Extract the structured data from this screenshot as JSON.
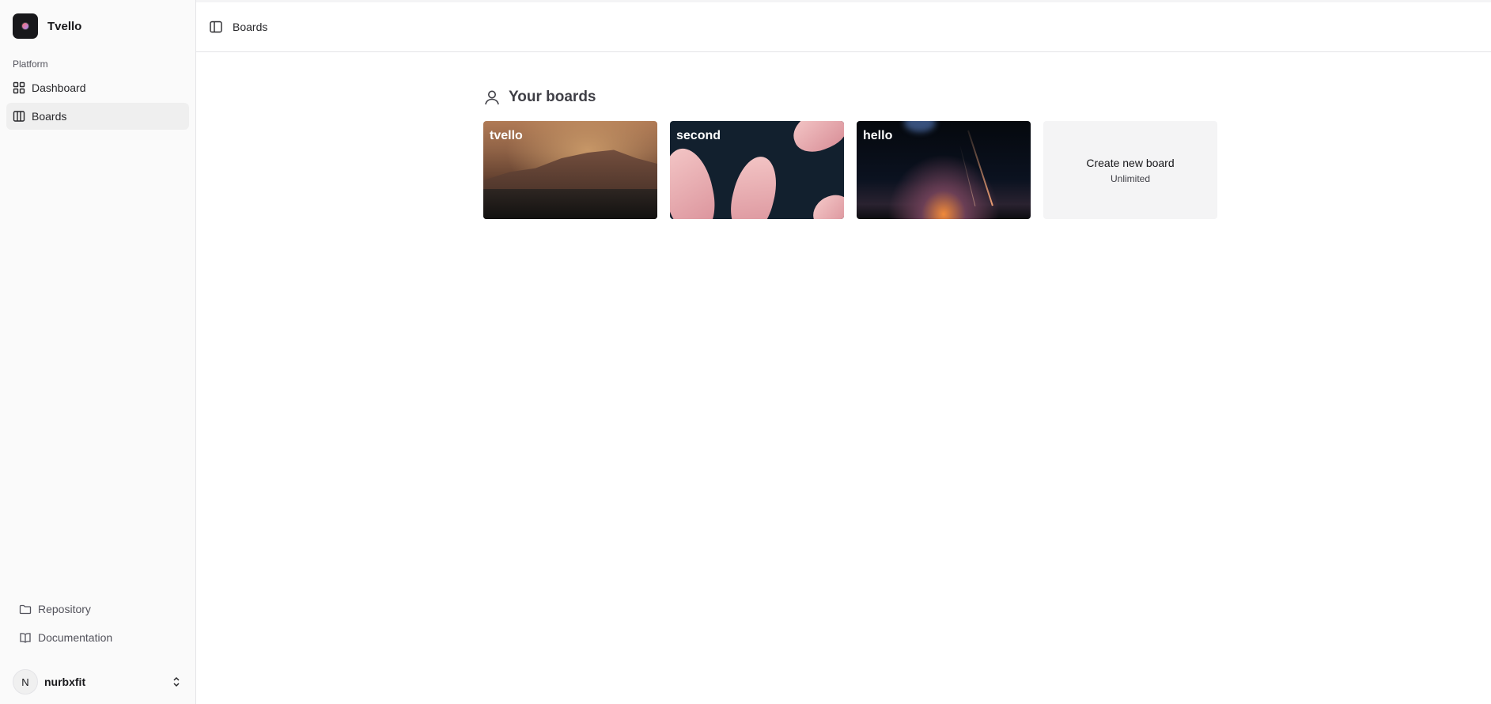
{
  "app": {
    "name": "Tvello"
  },
  "sidebar": {
    "group_label": "Platform",
    "items": [
      {
        "label": "Dashboard",
        "icon": "dashboard-icon",
        "active": false
      },
      {
        "label": "Boards",
        "icon": "boards-icon",
        "active": true
      }
    ],
    "secondary": [
      {
        "label": "Repository",
        "icon": "folder-icon"
      },
      {
        "label": "Documentation",
        "icon": "book-icon"
      }
    ],
    "user": {
      "initial": "N",
      "name": "nurbxfit"
    }
  },
  "header": {
    "breadcrumb": "Boards"
  },
  "main": {
    "section_title": "Your boards",
    "boards": [
      {
        "title": "tvello"
      },
      {
        "title": "second"
      },
      {
        "title": "hello"
      }
    ],
    "create": {
      "label": "Create new board",
      "sub": "Unlimited"
    }
  },
  "colors": {
    "accent": "#18181b",
    "sidebar_bg": "#fafafa",
    "active_item": "#efefef",
    "create_card": "#f4f4f5"
  }
}
